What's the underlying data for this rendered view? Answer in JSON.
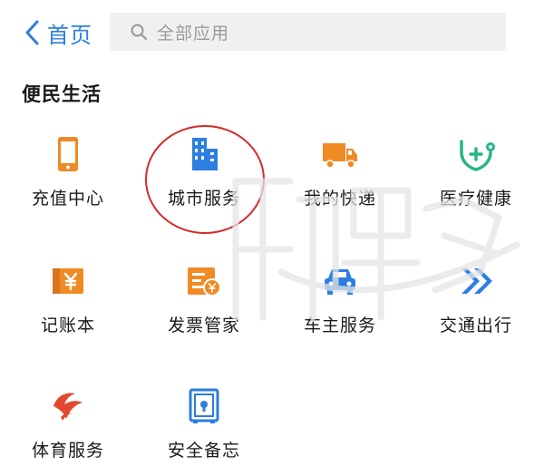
{
  "header": {
    "back_label": "首页",
    "search_placeholder": "全部应用"
  },
  "section": {
    "title": "便民生活"
  },
  "apps": [
    {
      "label": "充值中心",
      "icon": "phone-icon"
    },
    {
      "label": "城市服务",
      "icon": "building-icon"
    },
    {
      "label": "我的快递",
      "icon": "truck-icon"
    },
    {
      "label": "医疗健康",
      "icon": "heart-plus-icon"
    },
    {
      "label": "记账本",
      "icon": "ledger-yen-icon"
    },
    {
      "label": "发票管家",
      "icon": "invoice-icon"
    },
    {
      "label": "车主服务",
      "icon": "car-icon"
    },
    {
      "label": "交通出行",
      "icon": "double-chevron-icon"
    },
    {
      "label": "体育服务",
      "icon": "sports-icon"
    },
    {
      "label": "安全备忘",
      "icon": "safe-icon"
    }
  ],
  "colors": {
    "accent_blue": "#2c7fe0",
    "orange": "#f08a24",
    "green": "#27b58a",
    "red": "#e2492f",
    "highlight_circle": "#d42a2a"
  }
}
